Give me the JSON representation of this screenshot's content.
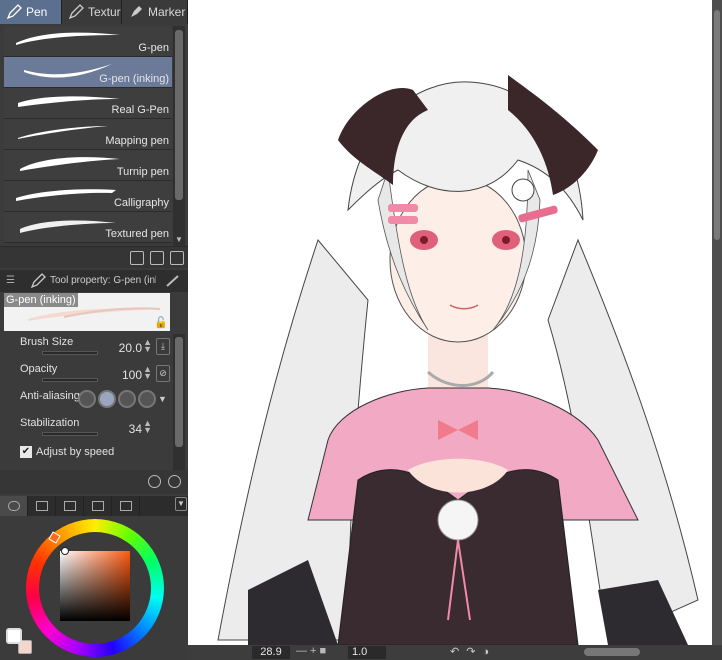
{
  "tool_tabs": [
    {
      "label": "Pen",
      "icon": "pen-icon",
      "active": true
    },
    {
      "label": "Texture",
      "icon": "pencil-icon",
      "active": false
    },
    {
      "label": "Marker",
      "icon": "marker-icon",
      "active": false
    }
  ],
  "brushes": [
    {
      "label": "G-pen",
      "selected": false
    },
    {
      "label": "G-pen (inking)",
      "selected": true
    },
    {
      "label": "Real G-Pen",
      "selected": false
    },
    {
      "label": "Mapping pen",
      "selected": false
    },
    {
      "label": "Turnip pen",
      "selected": false
    },
    {
      "label": "Calligraphy",
      "selected": false
    },
    {
      "label": "Textured pen",
      "selected": false
    }
  ],
  "tool_property": {
    "title": "Tool property: G-pen (inking)",
    "preview_name": "G-pen (inking)",
    "brush_size_label": "Brush Size",
    "brush_size_value": "20.0",
    "opacity_label": "Opacity",
    "opacity_value": "100",
    "anti_aliasing_label": "Anti-aliasing",
    "stabilization_label": "Stabilization",
    "stabilization_value": "34",
    "adjust_by_speed_label": "Adjust by speed",
    "adjust_by_speed_checked": true
  },
  "color": {
    "main_color": "#ffffff",
    "sub_color": "#f4d6cc",
    "picked_hue": "#ff5a10"
  },
  "status_bar": {
    "zoom": "28.9",
    "angle": "1.0"
  },
  "colors": {
    "panel_bg": "#3b3b3b",
    "selected_tab": "#5b6f8e",
    "selected_brush": "#6a7a98",
    "canvas_bg": "#ffffff"
  }
}
